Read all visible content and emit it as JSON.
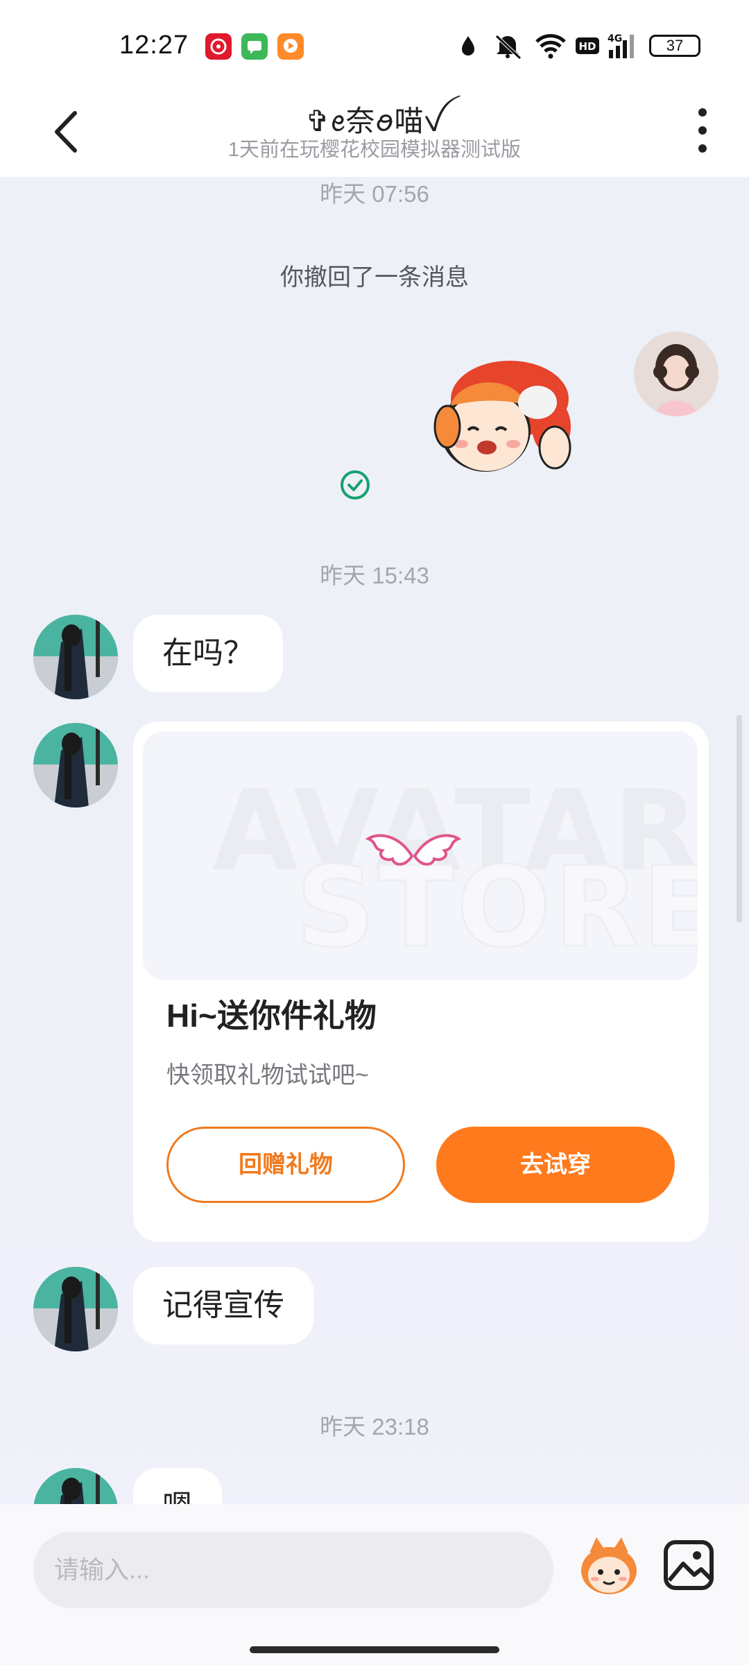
{
  "status_bar": {
    "time": "12:27",
    "battery": "37",
    "network": "4G",
    "hd": "HD",
    "icons": [
      "notification-app-icon",
      "message-app-icon",
      "video-app-icon",
      "data-saver-icon",
      "mute-icon",
      "wifi-icon",
      "hd-icon",
      "signal-icon",
      "battery-icon"
    ]
  },
  "header": {
    "title": "✞ꫀ奈ꪮ喵ꪜ",
    "subtitle": "1天前在玩樱花校园模拟器测试版"
  },
  "messages": {
    "ts1": "昨天 07:56",
    "recall": "你撤回了一条消息",
    "ts2": "昨天 15:43",
    "msg1": "在吗？",
    "msg2": "记得宣传",
    "ts3": "昨天 23:18",
    "msg3": "嗯"
  },
  "gift_card": {
    "watermark_top": "AVATAR",
    "watermark_bottom": "STORE",
    "title": "Hi~送你件礼物",
    "subtitle": "快领取礼物试试吧~",
    "return_gift_label": "回赠礼物",
    "try_on_label": "去试穿"
  },
  "input": {
    "placeholder": "请输入..."
  },
  "colors": {
    "accent": "#ff7a1c",
    "sent_check": "#16a06e",
    "timestamp": "#a3a6ae"
  }
}
